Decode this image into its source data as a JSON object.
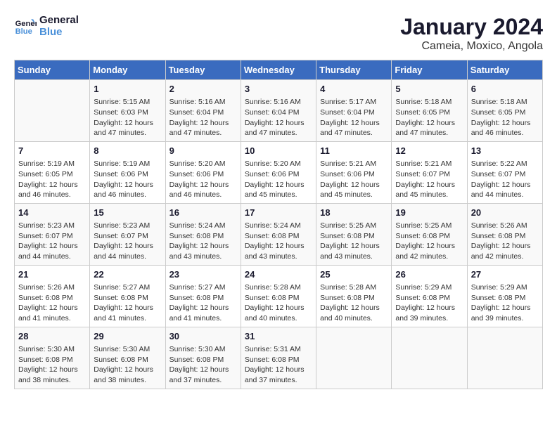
{
  "logo": {
    "line1": "General",
    "line2": "Blue"
  },
  "title": "January 2024",
  "subtitle": "Cameia, Moxico, Angola",
  "weekdays": [
    "Sunday",
    "Monday",
    "Tuesday",
    "Wednesday",
    "Thursday",
    "Friday",
    "Saturday"
  ],
  "weeks": [
    [
      {
        "day": "",
        "info": ""
      },
      {
        "day": "1",
        "info": "Sunrise: 5:15 AM\nSunset: 6:03 PM\nDaylight: 12 hours\nand 47 minutes."
      },
      {
        "day": "2",
        "info": "Sunrise: 5:16 AM\nSunset: 6:04 PM\nDaylight: 12 hours\nand 47 minutes."
      },
      {
        "day": "3",
        "info": "Sunrise: 5:16 AM\nSunset: 6:04 PM\nDaylight: 12 hours\nand 47 minutes."
      },
      {
        "day": "4",
        "info": "Sunrise: 5:17 AM\nSunset: 6:04 PM\nDaylight: 12 hours\nand 47 minutes."
      },
      {
        "day": "5",
        "info": "Sunrise: 5:18 AM\nSunset: 6:05 PM\nDaylight: 12 hours\nand 47 minutes."
      },
      {
        "day": "6",
        "info": "Sunrise: 5:18 AM\nSunset: 6:05 PM\nDaylight: 12 hours\nand 46 minutes."
      }
    ],
    [
      {
        "day": "7",
        "info": "Sunrise: 5:19 AM\nSunset: 6:05 PM\nDaylight: 12 hours\nand 46 minutes."
      },
      {
        "day": "8",
        "info": "Sunrise: 5:19 AM\nSunset: 6:06 PM\nDaylight: 12 hours\nand 46 minutes."
      },
      {
        "day": "9",
        "info": "Sunrise: 5:20 AM\nSunset: 6:06 PM\nDaylight: 12 hours\nand 46 minutes."
      },
      {
        "day": "10",
        "info": "Sunrise: 5:20 AM\nSunset: 6:06 PM\nDaylight: 12 hours\nand 45 minutes."
      },
      {
        "day": "11",
        "info": "Sunrise: 5:21 AM\nSunset: 6:06 PM\nDaylight: 12 hours\nand 45 minutes."
      },
      {
        "day": "12",
        "info": "Sunrise: 5:21 AM\nSunset: 6:07 PM\nDaylight: 12 hours\nand 45 minutes."
      },
      {
        "day": "13",
        "info": "Sunrise: 5:22 AM\nSunset: 6:07 PM\nDaylight: 12 hours\nand 44 minutes."
      }
    ],
    [
      {
        "day": "14",
        "info": "Sunrise: 5:23 AM\nSunset: 6:07 PM\nDaylight: 12 hours\nand 44 minutes."
      },
      {
        "day": "15",
        "info": "Sunrise: 5:23 AM\nSunset: 6:07 PM\nDaylight: 12 hours\nand 44 minutes."
      },
      {
        "day": "16",
        "info": "Sunrise: 5:24 AM\nSunset: 6:08 PM\nDaylight: 12 hours\nand 43 minutes."
      },
      {
        "day": "17",
        "info": "Sunrise: 5:24 AM\nSunset: 6:08 PM\nDaylight: 12 hours\nand 43 minutes."
      },
      {
        "day": "18",
        "info": "Sunrise: 5:25 AM\nSunset: 6:08 PM\nDaylight: 12 hours\nand 43 minutes."
      },
      {
        "day": "19",
        "info": "Sunrise: 5:25 AM\nSunset: 6:08 PM\nDaylight: 12 hours\nand 42 minutes."
      },
      {
        "day": "20",
        "info": "Sunrise: 5:26 AM\nSunset: 6:08 PM\nDaylight: 12 hours\nand 42 minutes."
      }
    ],
    [
      {
        "day": "21",
        "info": "Sunrise: 5:26 AM\nSunset: 6:08 PM\nDaylight: 12 hours\nand 41 minutes."
      },
      {
        "day": "22",
        "info": "Sunrise: 5:27 AM\nSunset: 6:08 PM\nDaylight: 12 hours\nand 41 minutes."
      },
      {
        "day": "23",
        "info": "Sunrise: 5:27 AM\nSunset: 6:08 PM\nDaylight: 12 hours\nand 41 minutes."
      },
      {
        "day": "24",
        "info": "Sunrise: 5:28 AM\nSunset: 6:08 PM\nDaylight: 12 hours\nand 40 minutes."
      },
      {
        "day": "25",
        "info": "Sunrise: 5:28 AM\nSunset: 6:08 PM\nDaylight: 12 hours\nand 40 minutes."
      },
      {
        "day": "26",
        "info": "Sunrise: 5:29 AM\nSunset: 6:08 PM\nDaylight: 12 hours\nand 39 minutes."
      },
      {
        "day": "27",
        "info": "Sunrise: 5:29 AM\nSunset: 6:08 PM\nDaylight: 12 hours\nand 39 minutes."
      }
    ],
    [
      {
        "day": "28",
        "info": "Sunrise: 5:30 AM\nSunset: 6:08 PM\nDaylight: 12 hours\nand 38 minutes."
      },
      {
        "day": "29",
        "info": "Sunrise: 5:30 AM\nSunset: 6:08 PM\nDaylight: 12 hours\nand 38 minutes."
      },
      {
        "day": "30",
        "info": "Sunrise: 5:30 AM\nSunset: 6:08 PM\nDaylight: 12 hours\nand 37 minutes."
      },
      {
        "day": "31",
        "info": "Sunrise: 5:31 AM\nSunset: 6:08 PM\nDaylight: 12 hours\nand 37 minutes."
      },
      {
        "day": "",
        "info": ""
      },
      {
        "day": "",
        "info": ""
      },
      {
        "day": "",
        "info": ""
      }
    ]
  ]
}
